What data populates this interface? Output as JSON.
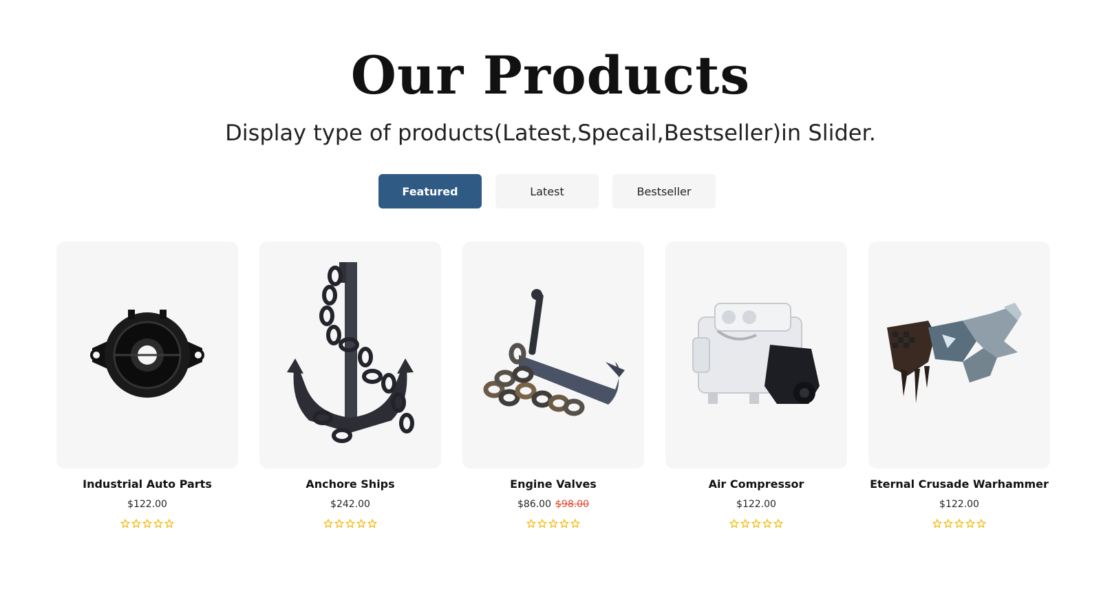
{
  "section": {
    "title": "Our Products",
    "subtitle": "Display type of products(Latest,Specail,Bestseller)in Slider."
  },
  "tabs": [
    {
      "label": "Featured",
      "active": true
    },
    {
      "label": "Latest",
      "active": false
    },
    {
      "label": "Bestseller",
      "active": false
    }
  ],
  "colors": {
    "accent": "#2e5a84",
    "star": "#f2b600",
    "old_price": "#e2462c",
    "card_bg": "#f6f6f6"
  },
  "products": [
    {
      "name": "Industrial Auto Parts",
      "price": "$122.00",
      "old_price": null,
      "rating": 0,
      "rating_max": 5,
      "image": "industrial-auto-part-image"
    },
    {
      "name": "Anchore Ships",
      "price": "$242.00",
      "old_price": null,
      "rating": 0,
      "rating_max": 5,
      "image": "ship-anchor-image"
    },
    {
      "name": "Engine Valves",
      "price": "$86.00",
      "old_price": "$98.00",
      "rating": 0,
      "rating_max": 5,
      "image": "anchor-with-chain-image"
    },
    {
      "name": "Air Compressor",
      "price": "$122.00",
      "old_price": null,
      "rating": 0,
      "rating_max": 5,
      "image": "engine-image"
    },
    {
      "name": "Eternal Crusade Warhammer",
      "price": "$122.00",
      "old_price": null,
      "rating": 0,
      "rating_max": 5,
      "image": "warhammer-image"
    }
  ]
}
